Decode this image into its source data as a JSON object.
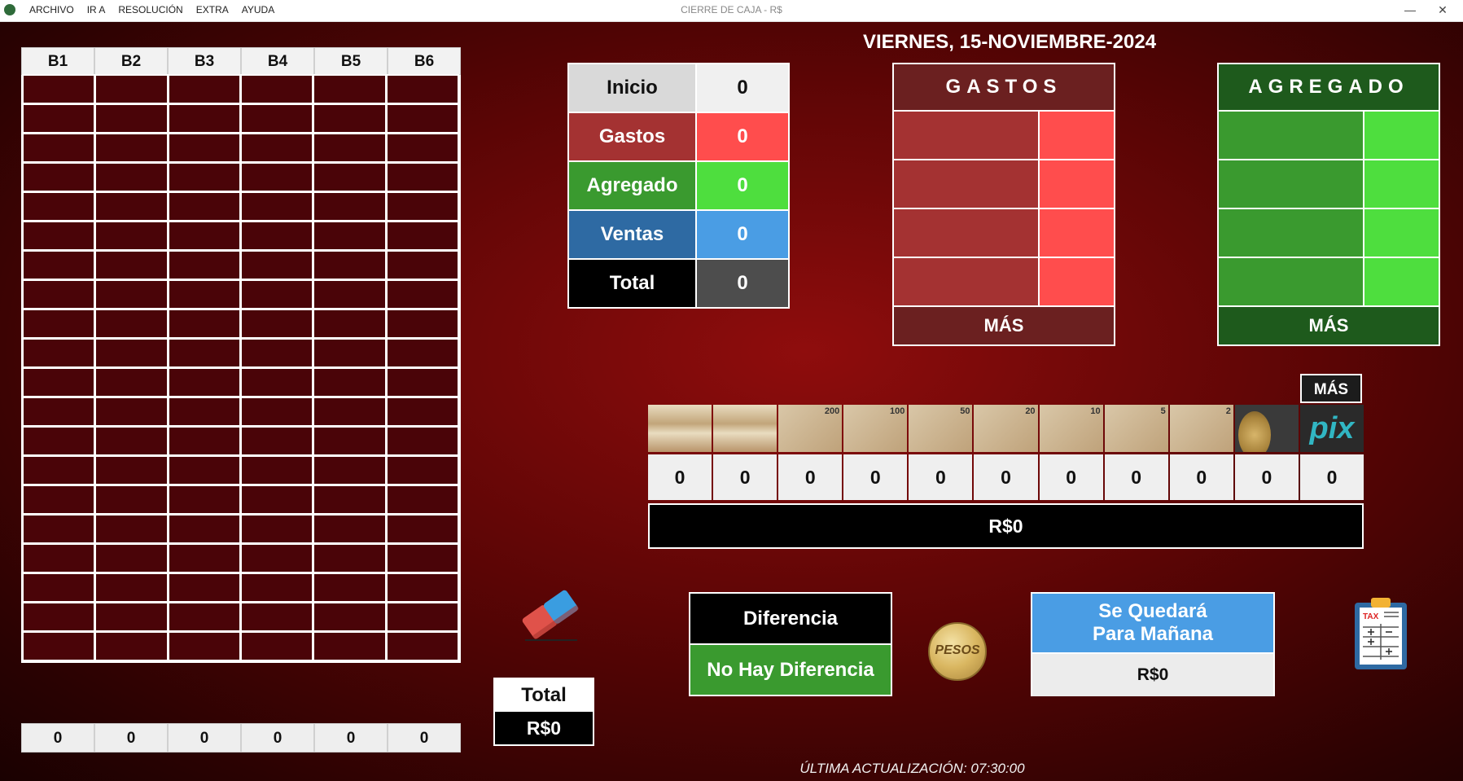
{
  "menu": [
    "ARCHIVO",
    "IR A",
    "RESOLUCIÓN",
    "EXTRA",
    "AYUDA"
  ],
  "window_title": "CIERRE DE CAJA - R$",
  "window_controls": {
    "minimize": "—",
    "close": "✕"
  },
  "date": "VIERNES, 15-NOVIEMBRE-2024",
  "grid": {
    "headers": [
      "B1",
      "B2",
      "B3",
      "B4",
      "B5",
      "B6"
    ],
    "row_count": 20,
    "totals": [
      "0",
      "0",
      "0",
      "0",
      "0",
      "0"
    ]
  },
  "summary": [
    {
      "label": "Inicio",
      "value": "0",
      "label_bg": "#d9d9d9",
      "label_color": "#111111",
      "value_bg": "#f0f0f0",
      "value_color": "#111111"
    },
    {
      "label": "Gastos",
      "value": "0",
      "label_bg": "#a43232",
      "label_color": "#ffffff",
      "value_bg": "#ff4d4d",
      "value_color": "#ffffff"
    },
    {
      "label": "Agregado",
      "value": "0",
      "label_bg": "#3a9a2f",
      "label_color": "#ffffff",
      "value_bg": "#4ede3e",
      "value_color": "#ffffff"
    },
    {
      "label": "Ventas",
      "value": "0",
      "label_bg": "#2e6aa3",
      "label_color": "#ffffff",
      "value_bg": "#4a9de4",
      "value_color": "#ffffff"
    },
    {
      "label": "Total",
      "value": "0",
      "label_bg": "#000000",
      "label_color": "#ffffff",
      "value_bg": "#4d4d4d",
      "value_color": "#ffffff"
    }
  ],
  "gastos": {
    "title": "GASTOS",
    "more": "MÁS",
    "head_color": "#6b2020",
    "cell_a": "#a43232",
    "cell_b": "#ff4d4d"
  },
  "agregado": {
    "title": "AGREGADO",
    "more": "MÁS",
    "head_color": "#1e5a1c",
    "cell_a": "#3a9a2f",
    "cell_b": "#4ede3e"
  },
  "denominations": {
    "more": "MÁS",
    "items": [
      {
        "icon": "bill-stack-icon",
        "label": "",
        "count": "0"
      },
      {
        "icon": "bill-stack-icon",
        "label": "",
        "count": "0"
      },
      {
        "icon": "bill-200-icon",
        "label": "200",
        "count": "0"
      },
      {
        "icon": "bill-100-icon",
        "label": "100",
        "count": "0"
      },
      {
        "icon": "bill-50-icon",
        "label": "50",
        "count": "0"
      },
      {
        "icon": "bill-20-icon",
        "label": "20",
        "count": "0"
      },
      {
        "icon": "bill-10-icon",
        "label": "10",
        "count": "0"
      },
      {
        "icon": "bill-5-icon",
        "label": "5",
        "count": "0"
      },
      {
        "icon": "bill-2-icon",
        "label": "2",
        "count": "0"
      },
      {
        "icon": "coins-icon",
        "label": "",
        "count": "0"
      },
      {
        "icon": "pix-icon",
        "label": "pix",
        "count": "0"
      }
    ],
    "total": "R$0"
  },
  "total_box": {
    "label": "Total",
    "value": "R$0"
  },
  "diferencia": {
    "label": "Diferencia",
    "value": "No Hay Diferencia"
  },
  "coin_logo": "PESOS",
  "quedara": {
    "label_line1": "Se Quedará",
    "label_line2": "Para Mañana",
    "value": "R$0"
  },
  "tax_label": "TAX",
  "updated": "ÚLTIMA ACTUALIZACIÓN: 07:30:00"
}
